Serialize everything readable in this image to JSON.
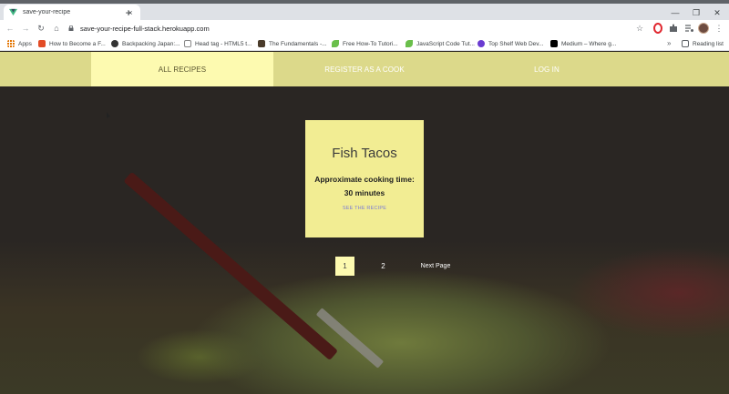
{
  "browser": {
    "tab_title": "save-your-recipe",
    "tab_close": "×",
    "new_tab": "+",
    "url": "save-your-recipe-full-stack.herokuapp.com",
    "controls": {
      "minimize": "—",
      "restore": "❐",
      "close": "✕"
    },
    "nav": {
      "back": "←",
      "forward": "→",
      "reload": "↻",
      "home": "⌂"
    },
    "toolbar_icons": {
      "star": "☆",
      "menu": "⋮"
    },
    "bookmarks": [
      {
        "label": "Apps",
        "color": "#e37400"
      },
      {
        "label": "How to Become a F...",
        "color": "#e34c26"
      },
      {
        "label": "Backpacking Japan:...",
        "color": "#333333"
      },
      {
        "label": "Head tag - HTML5 t...",
        "color": "#888888"
      },
      {
        "label": "The Fundamentals -...",
        "color": "#4a3b2a"
      },
      {
        "label": "Free How-To Tutori...",
        "color": "#6abf4b"
      },
      {
        "label": "JavaScript Code Tut...",
        "color": "#6abf4b"
      },
      {
        "label": "Top Shelf Web Dev...",
        "color": "#6a3bd1"
      },
      {
        "label": "Medium – Where g...",
        "color": "#000000"
      }
    ],
    "bookmarks_more": "»",
    "reading_list": "Reading list"
  },
  "navbar": {
    "items": [
      {
        "label": "ALL RECIPES",
        "active": true
      },
      {
        "label": "REGISTER AS A COOK",
        "active": false
      },
      {
        "label": "LOG IN",
        "active": false
      }
    ]
  },
  "recipe_card": {
    "title": "Fish Tacos",
    "cooking_time_label": "Approximate cooking time:",
    "cooking_time_value": "30 minutes",
    "link": "SEE THE RECIPE"
  },
  "pagination": {
    "pages": [
      "1",
      "2"
    ],
    "current": "1",
    "next": "Next Page"
  },
  "colors": {
    "navbar_bg": "#dcd98a",
    "nav_active_bg": "#fdfab0",
    "card_bg": "#f2ed93",
    "link": "#7a7bd6"
  }
}
